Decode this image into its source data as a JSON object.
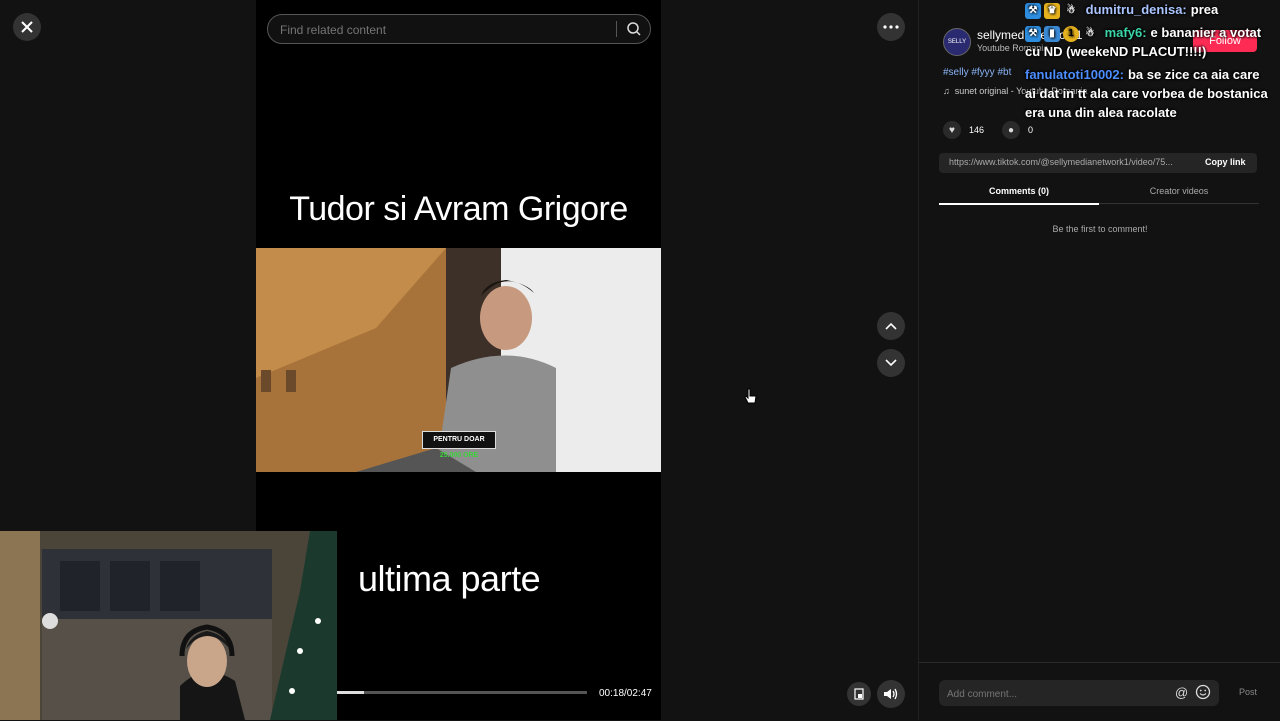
{
  "search": {
    "placeholder": "Find related content"
  },
  "video": {
    "title_text": "Tudor si Avram Grigore",
    "bottom_text": "ultima parte",
    "caption_badge_white": "PENTRU DOAR",
    "caption_badge_green": "25.000 ORE",
    "progress_fraction": 0.107,
    "time_display": "00:18/02:47"
  },
  "author": {
    "avatar_text": "SELLY",
    "username": "sellymedianetwork1",
    "subtitle": "Youtube Romania",
    "follow_label": "Follow"
  },
  "post": {
    "hashtags": "#selly #fyyy #bt",
    "sound": "sunet original - Youtube Romania",
    "likes": "146",
    "comments": "0",
    "link": "https://www.tiktok.com/@sellymedianetwork1/video/75...",
    "copy_link_label": "Copy link"
  },
  "tabs": {
    "comments_label": "Comments (0)",
    "creator_label": "Creator videos"
  },
  "comments": {
    "empty_message": "Be the first to comment!",
    "input_placeholder": "Add comment...",
    "post_label": "Post"
  },
  "chat": {
    "messages": [
      {
        "user": "dumitru_denisa:",
        "text": "prea",
        "user_color": "#aac4ff"
      },
      {
        "user": "mafy6:",
        "text": "e bananier a votat cu ND (weekeND PLACUT!!!!)",
        "user_color": "#3ad6a8"
      },
      {
        "user": "fanulatoti10002:",
        "text": "ba se zice ca aia care ai dat in tt ala care vorbea de bostanica era una din alea racolate",
        "user_color": "#4c8dff"
      }
    ]
  },
  "colors": {
    "accent": "#fe2c55",
    "hashtag": "#8ab4f8",
    "panel_bg": "#121212"
  }
}
